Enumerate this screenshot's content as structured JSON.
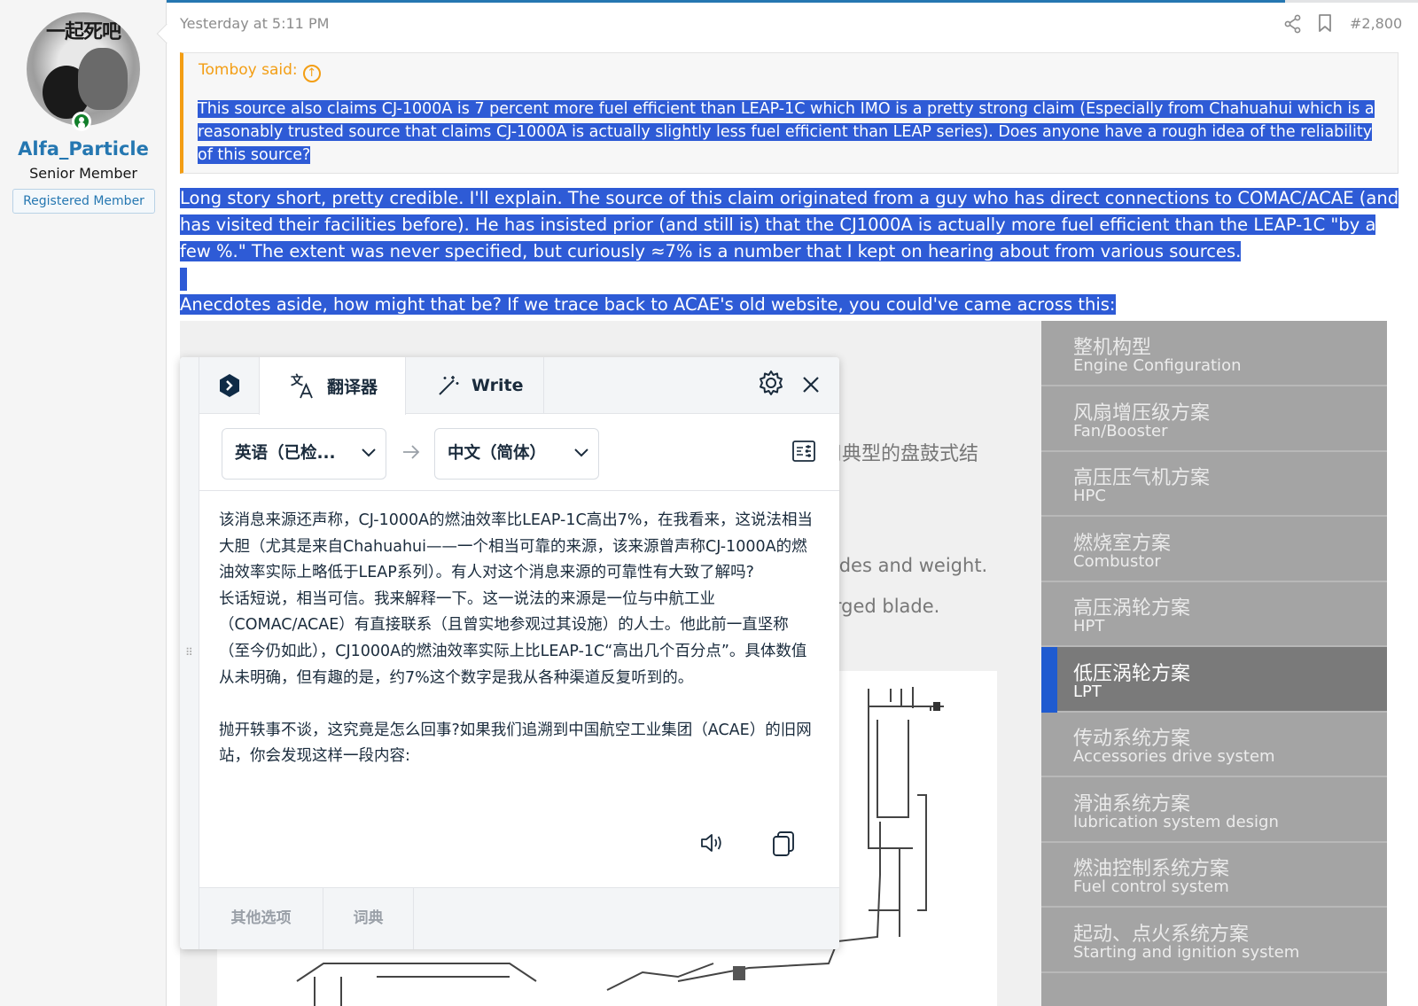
{
  "user": {
    "avatar_caption": "一起死吧",
    "name": "Alfa_Particle",
    "title": "Senior Member",
    "banner": "Registered Member"
  },
  "post": {
    "date": "Yesterday at 5:11 PM",
    "number": "#2,800",
    "quote": {
      "author": "Tomboy said:",
      "text": "This source also claims CJ-1000A is 7 percent more fuel efficient than LEAP-1C which IMO is a pretty strong claim (Especially from Chahuahui which is a reasonably trusted source that claims CJ-1000A is actually slightly less fuel efficient than LEAP series). Does anyone have a rough idea of the reliability of this source?"
    },
    "paragraph1": "Long story short, pretty credible. I'll explain. The source of this claim originated from a guy who has direct connections to COMAC/ACAE (and has visited their facilities before). He has insisted prior (and still is) that the CJ1000A is actually more fuel efficient than the LEAP-1C \"by a few %.\" The extent was never specified, but curiously ≈7% is a number that I kept on hearing about from various sources.",
    "paragraph2": "Anecdotes aside, how might that be? If we trace back to ACAE's old website, you could've came across this:"
  },
  "embed": {
    "fragment_zh": "用典型的盘鼓式结",
    "fragment_en1": "lades and weight.",
    "fragment_en2": "orged blade.",
    "menu": [
      {
        "zh": "整机构型",
        "en": "Engine Configuration"
      },
      {
        "zh": "风扇增压级方案",
        "en": "Fan/Booster"
      },
      {
        "zh": "高压压气机方案",
        "en": "HPC"
      },
      {
        "zh": "燃烧室方案",
        "en": "Combustor"
      },
      {
        "zh": "高压涡轮方案",
        "en": "HPT"
      },
      {
        "zh": "低压涡轮方案",
        "en": "LPT"
      },
      {
        "zh": "传动系统方案",
        "en": "Accessories drive system"
      },
      {
        "zh": "滑油系统方案",
        "en": "lubrication system design"
      },
      {
        "zh": "燃油控制系统方案",
        "en": "Fuel control system"
      },
      {
        "zh": "起动、点火系统方案",
        "en": "Starting and ignition system"
      }
    ]
  },
  "translator": {
    "tab_translator": "翻译器",
    "tab_write": "Write",
    "source_lang": "英语（已检...",
    "target_lang": "中文（简体）",
    "translation": "该消息来源还声称，CJ-1000A的燃油效率比LEAP-1C高出7%，在我看来，这说法相当大胆（尤其是来自Chahuahui——一个相当可靠的来源，该来源曾声称CJ-1000A的燃油效率实际上略低于LEAP系列）。有人对这个消息来源的可靠性有大致了解吗?\n长话短说，相当可信。我来解释一下。这一说法的来源是一位与中航工业（COMAC/ACAE）有直接联系（且曾实地参观过其设施）的人士。他此前一直坚称（至今仍如此），CJ1000A的燃油效率实际上比LEAP-1C“高出几个百分点”。具体数值从未明确，但有趣的是，约7%这个数字是我从各种渠道反复听到的。\n\n抛开轶事不谈，这究竟是怎么回事?如果我们追溯到中国航空工业集团（ACAE）的旧网站，你会发现这样一段内容:",
    "more_options": "其他选项",
    "dictionary": "词典"
  },
  "colors": {
    "link_blue": "#2577b1",
    "quote_accent": "#f39e14",
    "selection": "#2e5bd6",
    "menu_active_bar": "#1f5bd0"
  }
}
